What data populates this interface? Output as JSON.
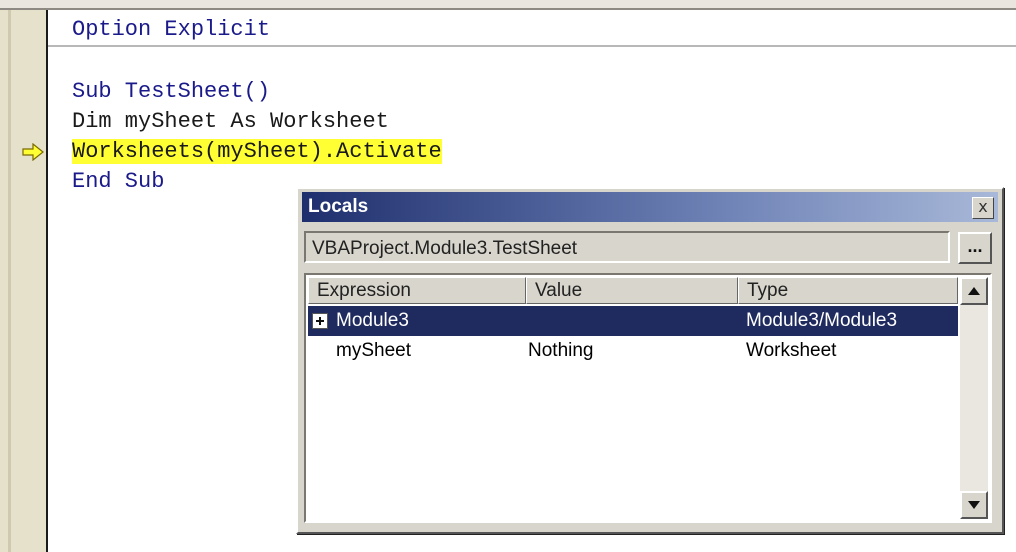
{
  "editor": {
    "declaration": "Option Explicit",
    "lines": [
      "Sub TestSheet()",
      "Dim mySheet As Worksheet",
      "Worksheets(mySheet).Activate",
      "End Sub"
    ],
    "highlight_color": "#ffff33",
    "execution_marker": "current-line-arrow-icon"
  },
  "locals": {
    "title": "Locals",
    "close_glyph": "x",
    "context": "VBAProject.Module3.TestSheet",
    "context_button": "...",
    "columns": [
      "Expression",
      "Value",
      "Type"
    ],
    "rows": [
      {
        "expression": "Module3",
        "value": "",
        "type": "Module3/Module3",
        "selected": true,
        "expandable": true
      },
      {
        "expression": "mySheet",
        "value": "Nothing",
        "type": "Worksheet",
        "selected": false,
        "expandable": false
      }
    ],
    "selection_color": "#1f2a5e"
  }
}
